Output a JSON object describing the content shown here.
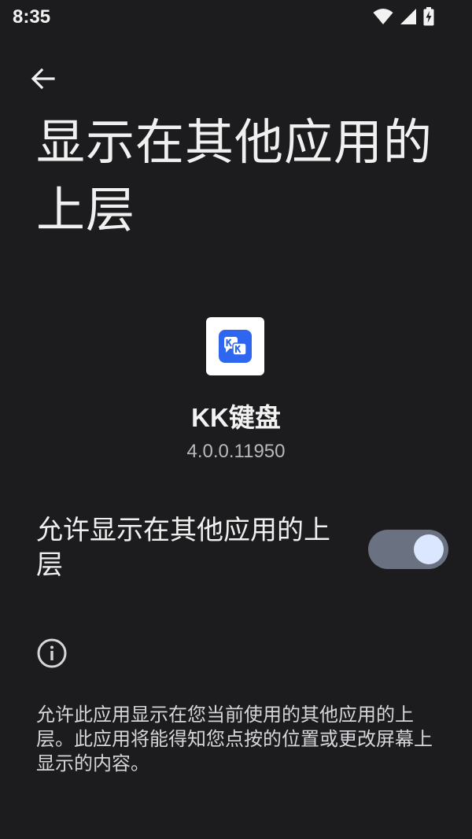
{
  "status_bar": {
    "time": "8:35",
    "icons": [
      "wifi-icon",
      "signal-icon",
      "battery-charging-icon"
    ]
  },
  "toolbar": {
    "back_icon": "arrow-back-icon"
  },
  "page": {
    "title": "显示在其他应用的上层"
  },
  "app": {
    "name": "KK键盘",
    "version": "4.0.0.11950",
    "icon_color": "#2f66f0"
  },
  "permission": {
    "label": "允许显示在其他应用的上层",
    "enabled": true,
    "toggle_track_color": "#6a7282",
    "toggle_knob_color": "#dbe6ff"
  },
  "info": {
    "icon": "info-icon",
    "text": "允许此应用显示在您当前使用的其他应用的上层。此应用将能得知您点按的位置或更改屏幕上显示的内容。"
  }
}
